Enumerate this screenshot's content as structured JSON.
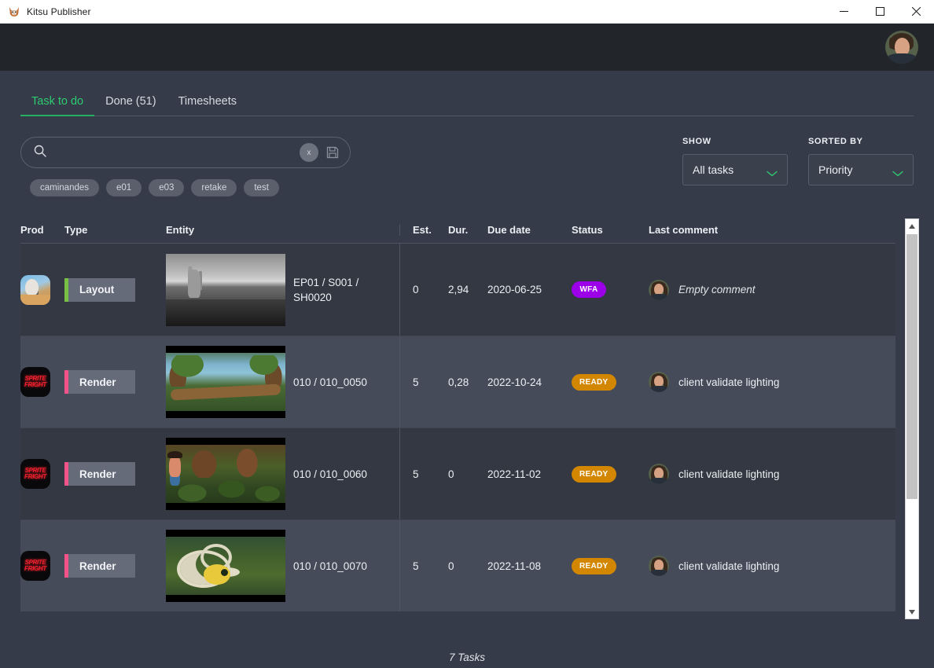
{
  "window": {
    "title": "Kitsu Publisher",
    "app_icon": "kitsu-fox-logo",
    "controls": {
      "minimize": "—",
      "maximize": "□",
      "close": "✕"
    }
  },
  "header": {
    "avatar": "user-avatar"
  },
  "tabs": [
    {
      "label": "Task to do",
      "active": true
    },
    {
      "label": "Done (51)",
      "active": false
    },
    {
      "label": "Timesheets",
      "active": false
    }
  ],
  "search": {
    "value": "",
    "placeholder": "",
    "icon": "search-icon",
    "clear_label": "x",
    "save_icon": "save-icon"
  },
  "chips": [
    "caminandes",
    "e01",
    "e03",
    "retake",
    "test"
  ],
  "filters": {
    "show": {
      "label": "SHOW",
      "value": "All tasks"
    },
    "sorted_by": {
      "label": "SORTED BY",
      "value": "Priority"
    }
  },
  "table": {
    "columns": [
      "Prod",
      "Type",
      "Entity",
      "Est.",
      "Dur.",
      "Due date",
      "Status",
      "Last comment"
    ],
    "rows": [
      {
        "prod": "caminandes",
        "prod_avatar": "caminandes-logo",
        "type": "Layout",
        "type_color": "#78c144",
        "thumbnail": "llama-plains-bw-thumbnail",
        "entity": "EP01 / S001 / SH0020",
        "est": "0",
        "dur": "2,94",
        "due_date": "2020-06-25",
        "status": "WFA",
        "status_color": "#9b00e8",
        "comment_avatar": "commenter-avatar",
        "comment": "Empty comment",
        "comment_empty": true
      },
      {
        "prod": "sprite-fright",
        "prod_avatar": "sprite-fright-logo",
        "type": "Render",
        "type_color": "#f2548a",
        "thumbnail": "forest-log-thumbnail",
        "entity": "010 / 010_0050",
        "est": "5",
        "dur": "0,28",
        "due_date": "2022-10-24",
        "status": "READY",
        "status_color": "#d38700",
        "comment_avatar": "commenter-avatar",
        "comment": "client validate lighting",
        "comment_empty": false
      },
      {
        "prod": "sprite-fright",
        "prod_avatar": "sprite-fright-logo",
        "type": "Render",
        "type_color": "#f2548a",
        "thumbnail": "jungle-boy-thumbnail",
        "entity": "010 / 010_0060",
        "est": "5",
        "dur": "0",
        "due_date": "2022-11-02",
        "status": "READY",
        "status_color": "#d38700",
        "comment_avatar": "commenter-avatar",
        "comment": "client validate lighting",
        "comment_empty": false
      },
      {
        "prod": "sprite-fright",
        "prod_avatar": "sprite-fright-logo",
        "type": "Render",
        "type_color": "#f2548a",
        "thumbnail": "mushroom-rings-thumbnail",
        "entity": "010 / 010_0070",
        "est": "5",
        "dur": "0",
        "due_date": "2022-11-08",
        "status": "READY",
        "status_color": "#d38700",
        "comment_avatar": "commenter-avatar",
        "comment": "client validate lighting",
        "comment_empty": false
      }
    ]
  },
  "footer": {
    "count_label": "7 Tasks"
  },
  "colors": {
    "accent_green": "#2ecc71",
    "page_bg": "#353b48",
    "header_bg": "#222529",
    "row_dark": "#333842",
    "row_light": "#454b58"
  }
}
